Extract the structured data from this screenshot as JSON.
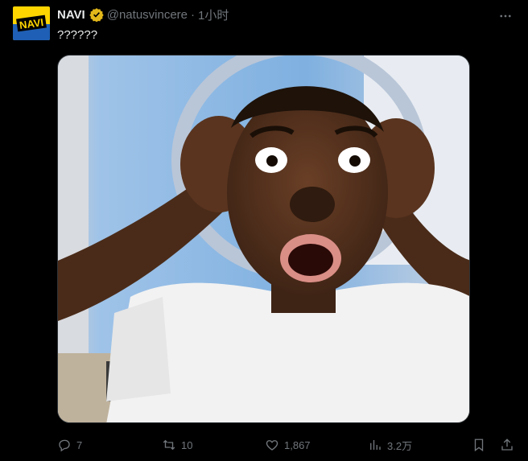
{
  "author": {
    "name": "NAVI",
    "handle": "@natusvincere",
    "separator": "·",
    "time": "1小时",
    "avatar_text": "NAVI"
  },
  "tweet": {
    "text": "??????"
  },
  "actions": {
    "replies": "7",
    "retweets": "10",
    "likes": "1,867",
    "views": "3.2万"
  },
  "icons": {
    "verified": "verified-badge-icon",
    "more": "more-icon",
    "reply": "reply-icon",
    "retweet": "retweet-icon",
    "like": "heart-icon",
    "views": "views-chart-icon",
    "bookmark": "bookmark-icon",
    "share": "share-icon"
  },
  "colors": {
    "background": "#000000",
    "text": "#e7e9ea",
    "muted": "#71767b",
    "verified_gold": "#e2b719",
    "avatar_yellow": "#ffd500",
    "avatar_blue": "#1f5fb5"
  }
}
